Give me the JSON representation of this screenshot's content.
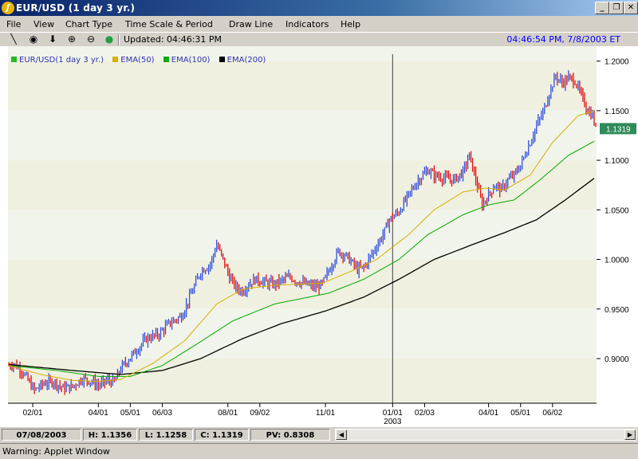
{
  "window": {
    "title": "EUR/USD (1 day  3 yr.)",
    "app_icon": "java-applet-icon",
    "minimize_label": "_",
    "restore_label": "❐",
    "close_label": "✕"
  },
  "menu": {
    "items": [
      "File",
      "View",
      "Chart Type",
      "Time Scale & Period",
      "Draw Line",
      "Indicators",
      "Help"
    ]
  },
  "toolbar": {
    "tools": [
      {
        "icon": "draw-line-icon",
        "glyph": "╲"
      },
      {
        "icon": "crosshair-icon",
        "glyph": "◉"
      },
      {
        "icon": "down-arrow-icon",
        "glyph": "⬇"
      },
      {
        "icon": "zoom-in-icon",
        "glyph": "⊕"
      },
      {
        "icon": "zoom-out-icon",
        "glyph": "⊖"
      },
      {
        "icon": "globe-icon",
        "glyph": "●"
      }
    ],
    "updated": "Updated: 04:46:31 PM",
    "clock": "04:46:54 PM, 7/8/2003 ET"
  },
  "legend": [
    {
      "label": "EUR/USD(1 day  3 yr.)",
      "color": "#22bb22"
    },
    {
      "label": "EMA(50)",
      "color": "#d4b000"
    },
    {
      "label": "EMA(100)",
      "color": "#00aa00"
    },
    {
      "label": "EMA(200)",
      "color": "#000000"
    }
  ],
  "colors": {
    "up_bar": "#3050e0",
    "down_bar": "#e01010",
    "band_light": "#f0f4ea",
    "band_dark": "#f0f0e0",
    "last_price_bg": "#2f8a5a",
    "period_divider": "#404040"
  },
  "chart_data": {
    "type": "line",
    "y_axis": {
      "min": 0.855,
      "max": 1.215,
      "ticks": [
        "0.9000",
        "0.9500",
        "1.0000",
        "1.0500",
        "1.1000",
        "1.1500",
        "1.2000"
      ],
      "tick_values": [
        0.9,
        0.95,
        1.0,
        1.05,
        1.1,
        1.15,
        1.2
      ]
    },
    "x_axis": {
      "labels": [
        "02/01",
        "04/01",
        "05/01",
        "06/03",
        "08/01",
        "09/02",
        "11/01",
        "01/01",
        "02/03",
        "04/01",
        "05/01",
        "06/02"
      ],
      "label_index": [
        15,
        56,
        76,
        96,
        137,
        157,
        198,
        240,
        260,
        300,
        320,
        340
      ],
      "year_label": "2003",
      "year_label_index": 240
    },
    "period_divider_index": 240,
    "n_bars": 368,
    "last_price": "1.1319",
    "price_keyframes": [
      [
        0,
        0.893
      ],
      [
        3,
        0.895
      ],
      [
        8,
        0.888
      ],
      [
        12,
        0.878
      ],
      [
        16,
        0.868
      ],
      [
        22,
        0.875
      ],
      [
        28,
        0.877
      ],
      [
        34,
        0.87
      ],
      [
        40,
        0.872
      ],
      [
        46,
        0.88
      ],
      [
        52,
        0.877
      ],
      [
        56,
        0.873
      ],
      [
        62,
        0.878
      ],
      [
        66,
        0.876
      ],
      [
        70,
        0.89
      ],
      [
        78,
        0.905
      ],
      [
        86,
        0.92
      ],
      [
        94,
        0.925
      ],
      [
        100,
        0.935
      ],
      [
        108,
        0.943
      ],
      [
        114,
        0.965
      ],
      [
        120,
        0.988
      ],
      [
        126,
        0.995
      ],
      [
        130,
        1.015
      ],
      [
        134,
        1.0
      ],
      [
        138,
        0.982
      ],
      [
        142,
        0.972
      ],
      [
        146,
        0.968
      ],
      [
        150,
        0.975
      ],
      [
        154,
        0.98
      ],
      [
        158,
        0.978
      ],
      [
        162,
        0.976
      ],
      [
        166,
        0.975
      ],
      [
        172,
        0.98
      ],
      [
        176,
        0.982
      ],
      [
        180,
        0.978
      ],
      [
        186,
        0.975
      ],
      [
        192,
        0.972
      ],
      [
        196,
        0.975
      ],
      [
        200,
        0.988
      ],
      [
        206,
        1.008
      ],
      [
        210,
        1.005
      ],
      [
        214,
        0.998
      ],
      [
        218,
        0.99
      ],
      [
        222,
        0.992
      ],
      [
        228,
        1.008
      ],
      [
        234,
        1.025
      ],
      [
        238,
        1.04
      ],
      [
        244,
        1.048
      ],
      [
        250,
        1.065
      ],
      [
        256,
        1.08
      ],
      [
        262,
        1.09
      ],
      [
        266,
        1.085
      ],
      [
        272,
        1.082
      ],
      [
        278,
        1.08
      ],
      [
        284,
        1.088
      ],
      [
        288,
        1.105
      ],
      [
        292,
        1.08
      ],
      [
        296,
        1.055
      ],
      [
        300,
        1.065
      ],
      [
        304,
        1.075
      ],
      [
        308,
        1.07
      ],
      [
        312,
        1.08
      ],
      [
        316,
        1.085
      ],
      [
        320,
        1.095
      ],
      [
        326,
        1.118
      ],
      [
        330,
        1.135
      ],
      [
        334,
        1.148
      ],
      [
        338,
        1.168
      ],
      [
        342,
        1.185
      ],
      [
        346,
        1.178
      ],
      [
        350,
        1.183
      ],
      [
        354,
        1.18
      ],
      [
        358,
        1.165
      ],
      [
        362,
        1.15
      ],
      [
        365,
        1.145
      ],
      [
        367,
        1.132
      ]
    ],
    "ema_keyframes": {
      "ema50": [
        [
          0,
          0.893
        ],
        [
          20,
          0.884
        ],
        [
          40,
          0.878
        ],
        [
          56,
          0.877
        ],
        [
          70,
          0.879
        ],
        [
          90,
          0.895
        ],
        [
          110,
          0.918
        ],
        [
          130,
          0.955
        ],
        [
          146,
          0.97
        ],
        [
          166,
          0.974
        ],
        [
          196,
          0.976
        ],
        [
          214,
          0.988
        ],
        [
          230,
          1.0
        ],
        [
          250,
          1.025
        ],
        [
          266,
          1.05
        ],
        [
          284,
          1.068
        ],
        [
          298,
          1.072
        ],
        [
          310,
          1.07
        ],
        [
          326,
          1.085
        ],
        [
          340,
          1.118
        ],
        [
          356,
          1.145
        ],
        [
          367,
          1.15
        ]
      ],
      "ema100": [
        [
          0,
          0.893
        ],
        [
          30,
          0.888
        ],
        [
          56,
          0.882
        ],
        [
          76,
          0.882
        ],
        [
          96,
          0.893
        ],
        [
          118,
          0.915
        ],
        [
          140,
          0.938
        ],
        [
          166,
          0.955
        ],
        [
          200,
          0.966
        ],
        [
          222,
          0.98
        ],
        [
          244,
          1.0
        ],
        [
          262,
          1.025
        ],
        [
          284,
          1.045
        ],
        [
          300,
          1.055
        ],
        [
          316,
          1.06
        ],
        [
          332,
          1.08
        ],
        [
          350,
          1.105
        ],
        [
          367,
          1.12
        ]
      ],
      "ema200": [
        [
          0,
          0.894
        ],
        [
          40,
          0.888
        ],
        [
          70,
          0.884
        ],
        [
          96,
          0.888
        ],
        [
          120,
          0.9
        ],
        [
          146,
          0.92
        ],
        [
          170,
          0.935
        ],
        [
          198,
          0.948
        ],
        [
          222,
          0.962
        ],
        [
          244,
          0.98
        ],
        [
          266,
          1.0
        ],
        [
          290,
          1.015
        ],
        [
          310,
          1.027
        ],
        [
          330,
          1.04
        ],
        [
          348,
          1.06
        ],
        [
          367,
          1.083
        ]
      ]
    }
  },
  "status": {
    "date": "07/08/2003",
    "high": "H: 1.1356",
    "low": "L: 1.1258",
    "close": "C: 1.1319",
    "pv": "PV: 0.8308"
  },
  "warning": "Warning: Applet Window"
}
